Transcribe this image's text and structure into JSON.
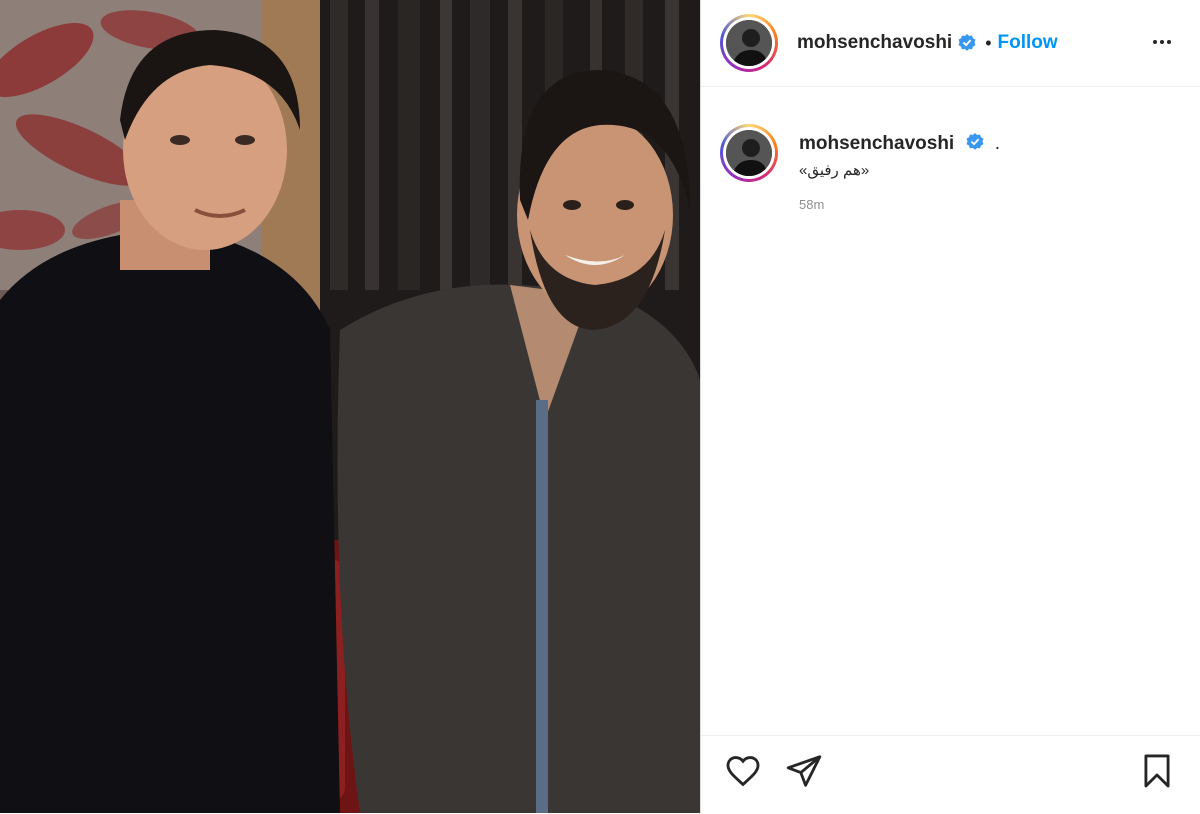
{
  "post": {
    "username": "mohsenchavoshi",
    "follow_label": "Follow",
    "separator": "•",
    "caption_suffix": ".",
    "caption": "«هم رفیق»",
    "timestamp": "58m"
  },
  "icons": {
    "verified": "verified-badge-icon",
    "more": "more-options-icon",
    "like": "heart-icon",
    "share": "paper-plane-icon",
    "save": "bookmark-icon"
  },
  "colors": {
    "follow": "#0095f6",
    "verified": "#3897f0",
    "muted": "#8e8e8e"
  }
}
